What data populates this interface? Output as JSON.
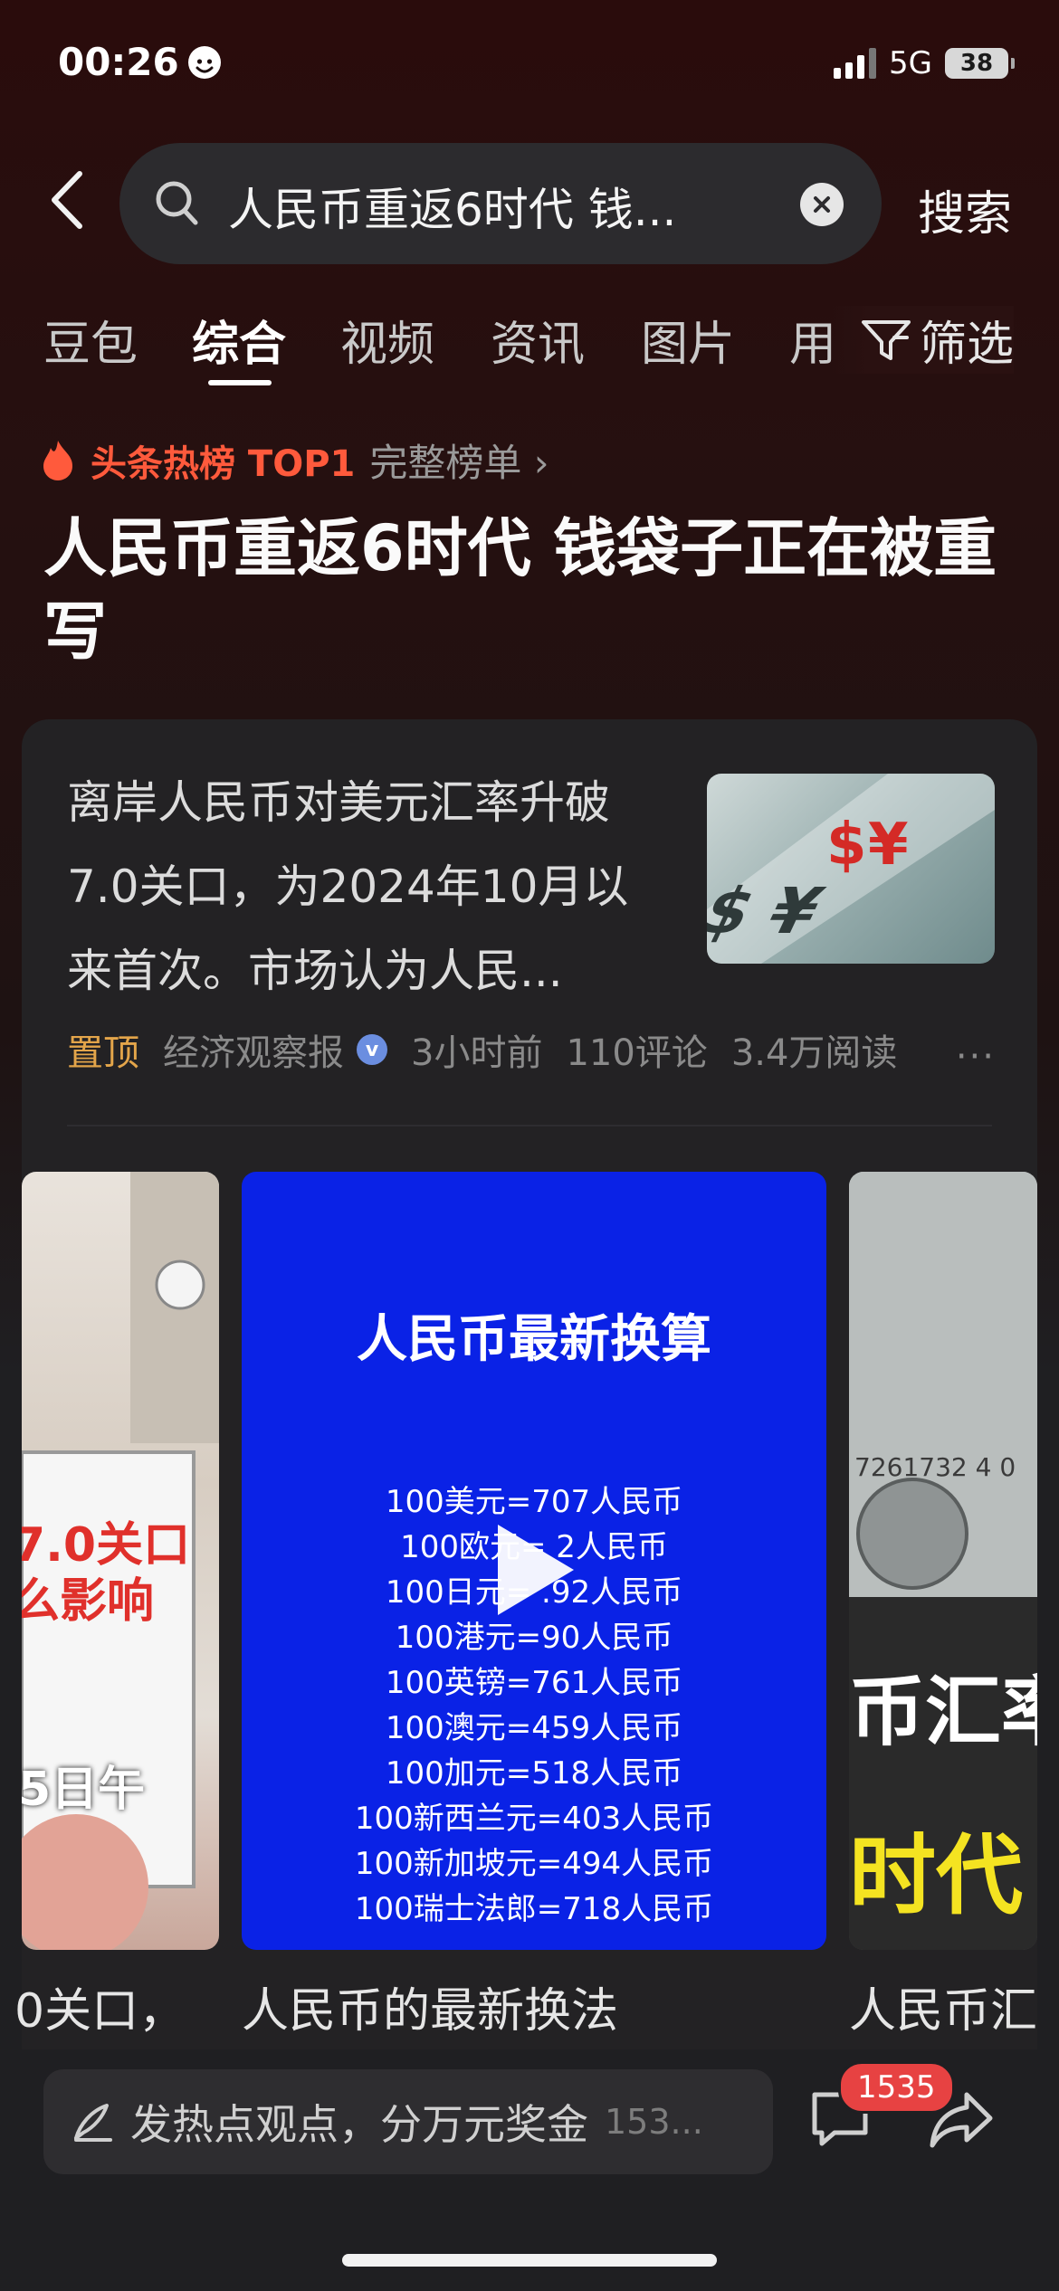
{
  "status_bar": {
    "time": "00:26",
    "network": "5G",
    "battery": "38"
  },
  "search": {
    "query": "人民币重返6时代 钱...",
    "submit_label": "搜索"
  },
  "tabs": [
    {
      "label": "豆包"
    },
    {
      "label": "综合"
    },
    {
      "label": "视频"
    },
    {
      "label": "资讯"
    },
    {
      "label": "图片"
    },
    {
      "label": "用"
    }
  ],
  "filter_label": "筛选",
  "hot_topic": {
    "label": "头条热榜 TOP1",
    "full_list": "完整榜单 ›"
  },
  "headline": "人民币重返6时代 钱袋子正在被重写",
  "article": {
    "text": "离岸人民币对美元汇率升破7.0关口，为2024年10月以来首次。市场认为人民...",
    "pin": "置顶",
    "source": "经济观察报",
    "time": "3小时前",
    "comments": "110评论",
    "reads": "3.4万阅读",
    "more": "···"
  },
  "videos": {
    "left": {
      "overlay_line1": "7.0关口",
      "overlay_line2": "么影响",
      "overlay_line3": "5日午",
      "caption": "0关口，"
    },
    "center": {
      "title": "人民币最新换算",
      "lines": [
        "100美元=707人民币",
        "100欧元=  2人民币",
        "100日元=  .92人民币",
        "100港元=90人民币",
        "100英镑=761人民币",
        "100澳元=459人民币",
        "100加元=518人民币",
        "100新西兰元=403人民币",
        "100新加坡元=494人民币",
        "100瑞士法郎=718人民币"
      ],
      "caption": "人民币的最新换法"
    },
    "right": {
      "serial": "7261732 4 0",
      "overlay_line1": "币汇率",
      "overlay_line2": "时代",
      "caption": "人民币汇"
    }
  },
  "bottom_bar": {
    "placeholder": "发热点观点，分万元奖金",
    "inline_count": "153...",
    "comment_badge": "1535"
  },
  "colors": {
    "hot_red": "#ff5a3c",
    "pin_orange": "#e3a54a",
    "video_blue": "#0a22e6",
    "badge_red": "#e74242"
  }
}
